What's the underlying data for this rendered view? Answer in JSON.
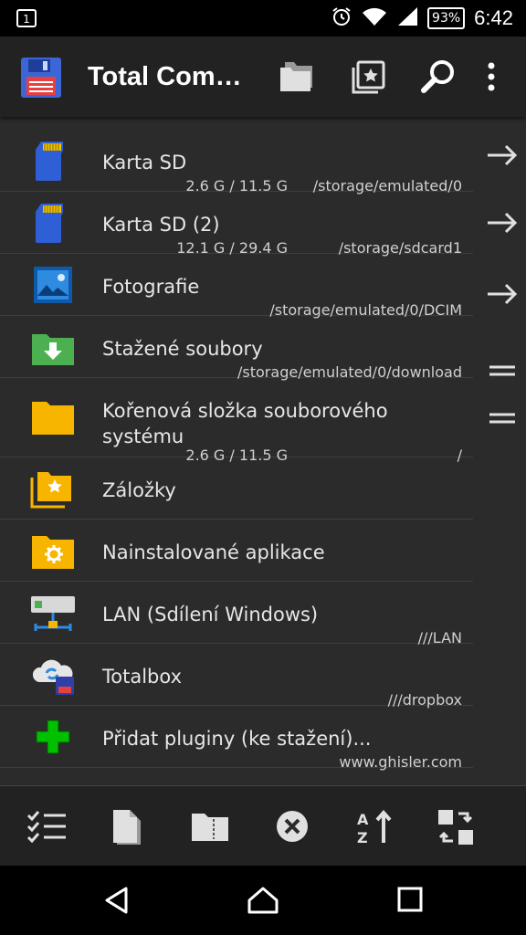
{
  "status": {
    "notification_badge": "1",
    "battery": "93%",
    "time": "6:42"
  },
  "toolbar": {
    "title": "Total Com…"
  },
  "entries": [
    {
      "name": "Karta SD",
      "size": "2.6 G / 11.5 G",
      "path": "/storage/emulated/0"
    },
    {
      "name": "Karta SD (2)",
      "size": "12.1 G / 29.4 G",
      "path": "/storage/sdcard1"
    },
    {
      "name": "Fotografie",
      "size": "",
      "path": "/storage/emulated/0/DCIM"
    },
    {
      "name": "Stažené soubory",
      "size": "",
      "path": "/storage/emulated/0/download"
    },
    {
      "name": "Kořenová složka souborového systému",
      "size": "2.6 G / 11.5 G",
      "path": "/"
    },
    {
      "name": "Záložky",
      "size": "",
      "path": ""
    },
    {
      "name": "Nainstalované aplikace",
      "size": "",
      "path": ""
    },
    {
      "name": "LAN (Sdílení Windows)",
      "size": "",
      "path": "///LAN"
    },
    {
      "name": "Totalbox",
      "size": "",
      "path": "///dropbox"
    },
    {
      "name": "Přidat pluginy (ke stažení)...",
      "size": "",
      "path": "www.ghisler.com"
    }
  ],
  "colors": {
    "background": "#2b2b2b",
    "toolbar": "#222222",
    "sd_blue": "#2f5fd6",
    "folder_yellow": "#f7b500",
    "download_green": "#4caf50",
    "plugin_green": "#00c000"
  }
}
